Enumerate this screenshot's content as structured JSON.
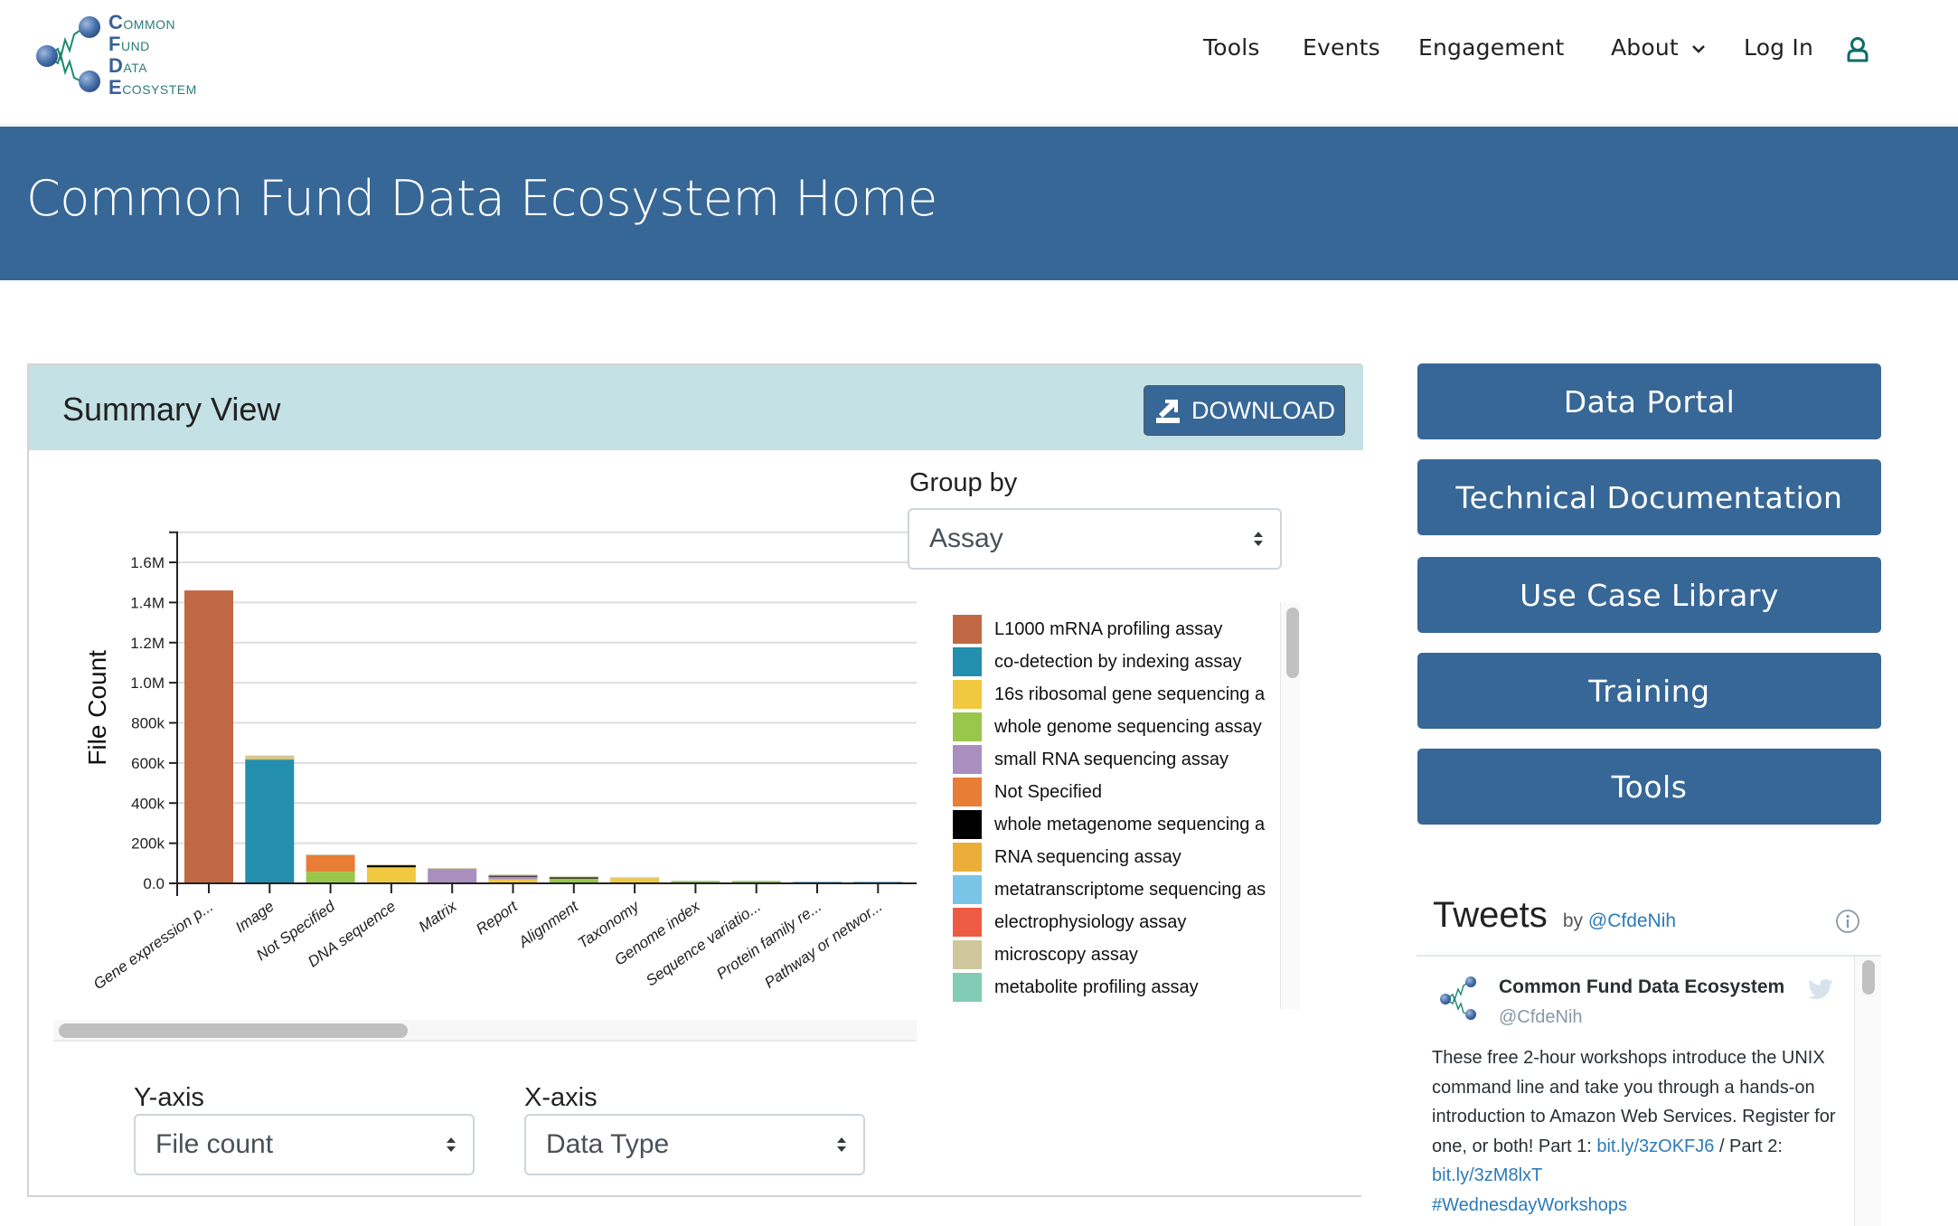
{
  "nav": {
    "logo": {
      "lines": [
        {
          "initial": "C",
          "rest": "OMMON"
        },
        {
          "initial": "F",
          "rest": "UND"
        },
        {
          "initial": "D",
          "rest": "ATA"
        },
        {
          "initial": "E",
          "rest": "COSYSTEM"
        }
      ]
    },
    "links": [
      {
        "label": "Tools"
      },
      {
        "label": "Events"
      },
      {
        "label": "Engagement"
      },
      {
        "label": "About"
      },
      {
        "label": "Log In"
      }
    ],
    "icons": {
      "about_dropdown": "chevron-down-icon",
      "user": "user-icon"
    }
  },
  "hero": {
    "title": "Common Fund Data Ecosystem Home"
  },
  "summary": {
    "title": "Summary View",
    "download_label": "DOWNLOAD",
    "group_by": {
      "label": "Group by",
      "value": "Assay"
    },
    "y_axis": {
      "label": "Y-axis",
      "value": "File count"
    },
    "x_axis": {
      "label": "X-axis",
      "value": "Data Type"
    }
  },
  "chart_data": {
    "type": "bar",
    "stacked": true,
    "title": "",
    "xlabel": "",
    "ylabel": "File Count",
    "ylim": [
      0,
      1750000
    ],
    "yticks": [
      0,
      200000,
      400000,
      600000,
      800000,
      1000000,
      1200000,
      1400000,
      1600000
    ],
    "ytick_labels": [
      "0.0",
      "200k",
      "400k",
      "600k",
      "800k",
      "1.0M",
      "1.2M",
      "1.4M",
      "1.6M"
    ],
    "grid": true,
    "legend_position": "right",
    "categories": [
      "Gene expression p...",
      "Image",
      "Not Specified",
      "DNA sequence",
      "Matrix",
      "Report",
      "Alignment",
      "Taxonomy",
      "Genome index",
      "Sequence variatio...",
      "Protein family re...",
      "Pathway or networ..."
    ],
    "series": [
      {
        "name": "L1000 mRNA profiling assay",
        "color": "#c06843",
        "values": [
          1460000,
          0,
          0,
          0,
          0,
          0,
          0,
          0,
          0,
          0,
          0,
          0
        ]
      },
      {
        "name": "co-detection by indexing assay",
        "color": "#238eae",
        "values": [
          0,
          617000,
          0,
          0,
          0,
          0,
          0,
          0,
          0,
          0,
          0,
          0
        ]
      },
      {
        "name": "16s ribosomal gene sequencing a",
        "color": "#f1c940",
        "values": [
          0,
          0,
          0,
          80000,
          0,
          20000,
          0,
          26000,
          0,
          0,
          0,
          0
        ]
      },
      {
        "name": "whole genome sequencing assay",
        "color": "#98c74b",
        "values": [
          0,
          0,
          58000,
          0,
          0,
          0,
          24000,
          0,
          12000,
          12000,
          0,
          0
        ]
      },
      {
        "name": "small RNA sequencing assay",
        "color": "#a88fc0",
        "values": [
          0,
          0,
          0,
          0,
          74000,
          14000,
          0,
          0,
          0,
          0,
          0,
          0
        ]
      },
      {
        "name": "Not Specified",
        "color": "#e87d35",
        "values": [
          0,
          0,
          82000,
          0,
          0,
          0,
          0,
          0,
          0,
          0,
          0,
          0
        ]
      },
      {
        "name": "whole metagenome sequencing a",
        "color": "#000000",
        "values": [
          0,
          0,
          0,
          10000,
          0,
          4000,
          6000,
          0,
          0,
          0,
          7000,
          7000
        ]
      },
      {
        "name": "RNA sequencing assay",
        "color": "#ebaf39",
        "values": [
          0,
          4000,
          0,
          0,
          0,
          4000,
          0,
          0,
          0,
          0,
          0,
          0
        ]
      },
      {
        "name": "metatranscriptome sequencing as",
        "color": "#7ac5e7",
        "values": [
          0,
          0,
          0,
          0,
          0,
          0,
          0,
          0,
          0,
          0,
          2000,
          2000
        ]
      },
      {
        "name": "electrophysiology assay",
        "color": "#ee5b45",
        "values": [
          0,
          0,
          0,
          0,
          0,
          0,
          0,
          0,
          0,
          0,
          0,
          0
        ]
      },
      {
        "name": "microscopy assay",
        "color": "#d0c79c",
        "values": [
          0,
          16000,
          4000,
          4000,
          2000,
          2000,
          4000,
          4000,
          0,
          0,
          0,
          0
        ]
      },
      {
        "name": "metabolite profiling assay",
        "color": "#82cbb4",
        "values": [
          0,
          0,
          0,
          0,
          0,
          0,
          0,
          0,
          0,
          0,
          0,
          0
        ]
      }
    ]
  },
  "side_buttons": [
    {
      "label": "Data Portal"
    },
    {
      "label": "Technical Documentation"
    },
    {
      "label": "Use Case Library"
    },
    {
      "label": "Training"
    },
    {
      "label": "Tools"
    }
  ],
  "tweets": {
    "title": "Tweets",
    "by": "by",
    "handle": "@CfdeNih",
    "tweet": {
      "name": "Common Fund Data Ecosystem",
      "user": "@CfdeNih",
      "text_1": "These free 2-hour workshops introduce the UNIX command line and take you through a hands-on introduction to Amazon Web Services. Register for one, or both! Part 1: ",
      "link_1": "bit.ly/3zOKFJ6",
      "text_2": " / Part 2: ",
      "link_2": "bit.ly/3zM8lxT",
      "hashtag": "#WednesdayWorkshops"
    }
  }
}
